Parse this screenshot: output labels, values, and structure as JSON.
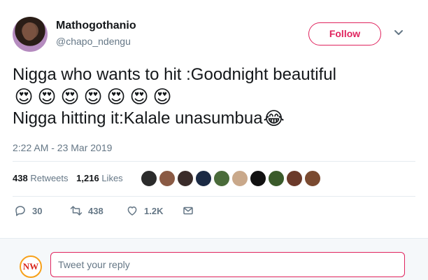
{
  "author": {
    "display_name": "Mathogothanio",
    "handle": "@chapo_ndengu",
    "avatar_icon": "profile-photo"
  },
  "follow_button": {
    "label": "Follow",
    "color": "#e0245e"
  },
  "tweet": {
    "line1": "Nigga who wants to hit :Goodnight beautiful",
    "emoji_line": [
      "😍",
      "😍",
      "😍",
      "😍",
      "😍",
      "😍",
      "😍"
    ],
    "line3": "Nigga hitting it:Kalale unasumbua",
    "line3_emoji": "😂",
    "timestamp": "2:22 AM - 23 Mar 2019"
  },
  "stats": {
    "retweets_count": "438",
    "retweets_label": "Retweets",
    "likes_count": "1,216",
    "likes_label": "Likes"
  },
  "likers": [
    {
      "name": "liker-1",
      "color": "#2b2b2b"
    },
    {
      "name": "liker-2",
      "color": "#8a5a44"
    },
    {
      "name": "liker-3",
      "color": "#3a2c2a"
    },
    {
      "name": "liker-4",
      "color": "#1b2a44"
    },
    {
      "name": "liker-5",
      "color": "#4a6b3a"
    },
    {
      "name": "liker-6",
      "color": "#c9a88a"
    },
    {
      "name": "liker-7",
      "color": "#111111"
    },
    {
      "name": "liker-8",
      "color": "#3a5a2a"
    },
    {
      "name": "liker-9",
      "color": "#6b3a2a"
    },
    {
      "name": "liker-10",
      "color": "#7a4a30"
    }
  ],
  "actions": {
    "reply_count": "30",
    "retweet_count": "438",
    "like_count": "1.2K"
  },
  "reply_bar": {
    "placeholder": "Tweet your reply",
    "logo_text": "NW"
  }
}
